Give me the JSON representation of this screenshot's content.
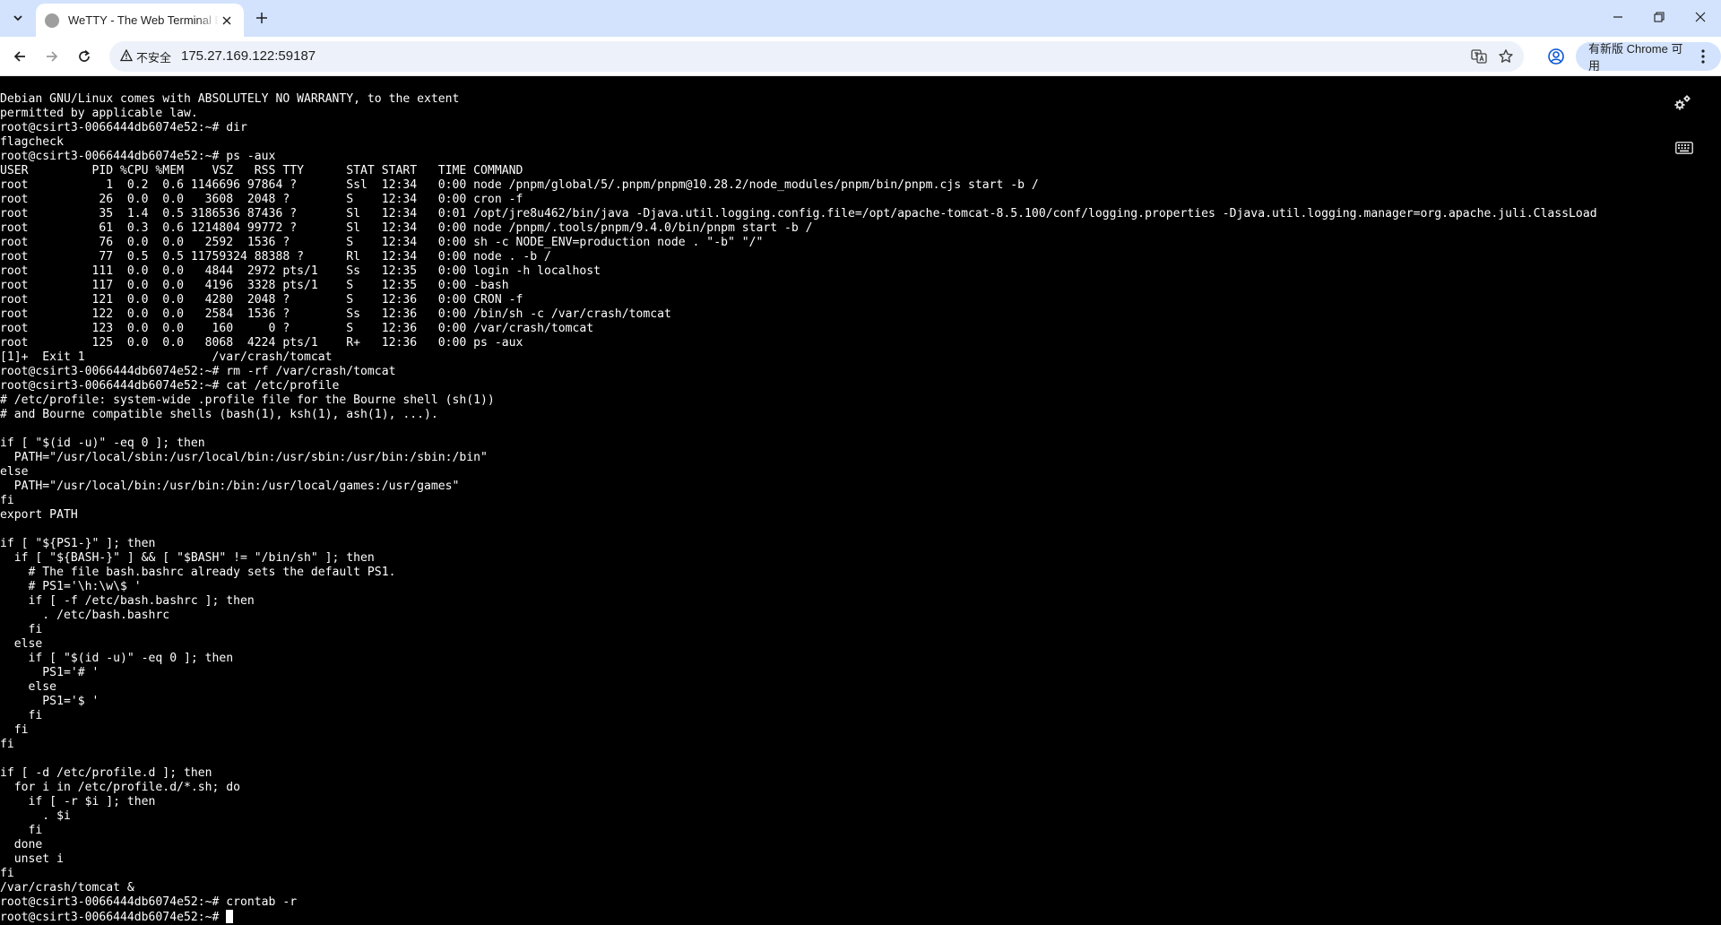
{
  "browser": {
    "tab": {
      "title": "WeTTY - The Web Terminal Emulator"
    },
    "address": {
      "security_label": "不安全",
      "url": "175.27.169.122:59187"
    },
    "update_button_label": "有新版 Chrome 可用"
  },
  "terminal": {
    "prompt": "root@csirt3-0066444db6074e52:~# ",
    "lines": [
      "Debian GNU/Linux comes with ABSOLUTELY NO WARRANTY, to the extent",
      "permitted by applicable law.",
      "root@csirt3-0066444db6074e52:~# dir",
      "flagcheck",
      "root@csirt3-0066444db6074e52:~# ps -aux",
      "USER         PID %CPU %MEM    VSZ   RSS TTY      STAT START   TIME COMMAND",
      "root           1  0.2  0.6 1146696 97864 ?       Ssl  12:34   0:00 node /pnpm/global/5/.pnpm/pnpm@10.28.2/node_modules/pnpm/bin/pnpm.cjs start -b /",
      "root          26  0.0  0.0   3608  2048 ?        S    12:34   0:00 cron -f",
      "root          35  1.4  0.5 3186536 87436 ?       Sl   12:34   0:01 /opt/jre8u462/bin/java -Djava.util.logging.config.file=/opt/apache-tomcat-8.5.100/conf/logging.properties -Djava.util.logging.manager=org.apache.juli.ClassLoad",
      "root          61  0.3  0.6 1214804 99772 ?       Sl   12:34   0:00 node /pnpm/.tools/pnpm/9.4.0/bin/pnpm start -b /",
      "root          76  0.0  0.0   2592  1536 ?        S    12:34   0:00 sh -c NODE_ENV=production node . \"-b\" \"/\"",
      "root          77  0.5  0.5 11759324 88388 ?      Rl   12:34   0:00 node . -b /",
      "root         111  0.0  0.0   4844  2972 pts/1    Ss   12:35   0:00 login -h localhost",
      "root         117  0.0  0.0   4196  3328 pts/1    S    12:35   0:00 -bash",
      "root         121  0.0  0.0   4280  2048 ?        S    12:36   0:00 CRON -f",
      "root         122  0.0  0.0   2584  1536 ?        Ss   12:36   0:00 /bin/sh -c /var/crash/tomcat",
      "root         123  0.0  0.0    160     0 ?        S    12:36   0:00 /var/crash/tomcat",
      "root         125  0.0  0.0   8068  4224 pts/1    R+   12:36   0:00 ps -aux",
      "[1]+  Exit 1                  /var/crash/tomcat",
      "root@csirt3-0066444db6074e52:~# rm -rf /var/crash/tomcat",
      "root@csirt3-0066444db6074e52:~# cat /etc/profile",
      "# /etc/profile: system-wide .profile file for the Bourne shell (sh(1))",
      "# and Bourne compatible shells (bash(1), ksh(1), ash(1), ...).",
      "",
      "if [ \"$(id -u)\" -eq 0 ]; then",
      "  PATH=\"/usr/local/sbin:/usr/local/bin:/usr/sbin:/usr/bin:/sbin:/bin\"",
      "else",
      "  PATH=\"/usr/local/bin:/usr/bin:/bin:/usr/local/games:/usr/games\"",
      "fi",
      "export PATH",
      "",
      "if [ \"${PS1-}\" ]; then",
      "  if [ \"${BASH-}\" ] && [ \"$BASH\" != \"/bin/sh\" ]; then",
      "    # The file bash.bashrc already sets the default PS1.",
      "    # PS1='\\h:\\w\\$ '",
      "    if [ -f /etc/bash.bashrc ]; then",
      "      . /etc/bash.bashrc",
      "    fi",
      "  else",
      "    if [ \"$(id -u)\" -eq 0 ]; then",
      "      PS1='# '",
      "    else",
      "      PS1='$ '",
      "    fi",
      "  fi",
      "fi",
      "",
      "if [ -d /etc/profile.d ]; then",
      "  for i in /etc/profile.d/*.sh; do",
      "    if [ -r $i ]; then",
      "      . $i",
      "    fi",
      "  done",
      "  unset i",
      "fi",
      "/var/crash/tomcat &",
      "root@csirt3-0066444db6074e52:~# crontab -r"
    ]
  },
  "colors": {
    "tabstrip_bg": "#d3e3fd",
    "terminal_bg": "#000000",
    "terminal_fg": "#ffffff"
  },
  "icons": [
    "tab-search-icon",
    "tab-favicon",
    "tab-close-icon",
    "new-tab-icon",
    "minimize-icon",
    "restore-icon",
    "close-window-icon",
    "back-icon",
    "forward-icon",
    "reload-icon",
    "warning-icon",
    "translate-icon",
    "bookmark-star-icon",
    "profile-icon",
    "more-vertical-icon",
    "settings-gears-icon",
    "keyboard-icon"
  ]
}
